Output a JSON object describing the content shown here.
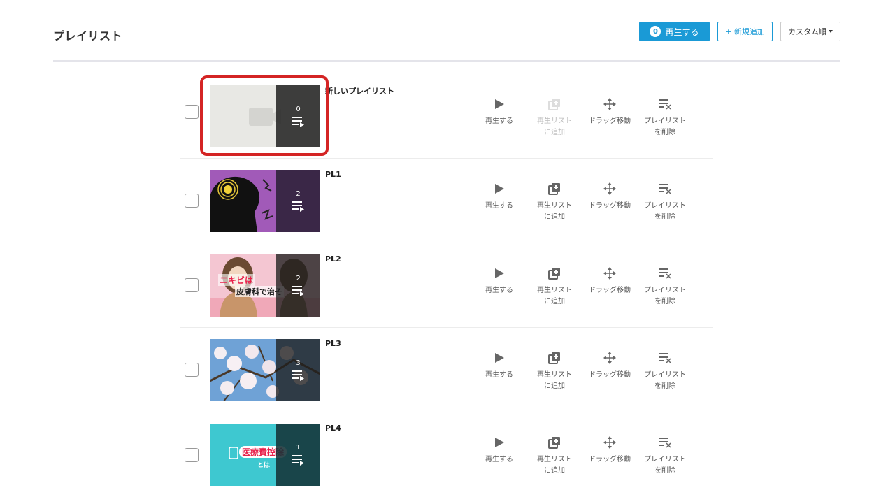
{
  "header": {
    "title": "プレイリスト",
    "play_count": "0",
    "play_label": "再生する",
    "new_label": "+ 新規追加",
    "sort_label": "カスタム順"
  },
  "actions": {
    "play": "再生する",
    "add_line1": "再生リスト",
    "add_line2": "に追加",
    "drag": "ドラッグ移動",
    "delete_line1": "プレイリスト",
    "delete_line2": "を削除"
  },
  "playlists": [
    {
      "name": "新しいプレイリスト",
      "count": "0",
      "thumb": "empty",
      "add_enabled": false
    },
    {
      "name": "PL1",
      "count": "2",
      "thumb": "head",
      "add_enabled": true
    },
    {
      "name": "PL2",
      "count": "2",
      "thumb": "girl",
      "add_enabled": true,
      "thumb_text1": "ニキビは",
      "thumb_text2": "皮膚科で治そ"
    },
    {
      "name": "PL3",
      "count": "3",
      "thumb": "sakura",
      "add_enabled": true
    },
    {
      "name": "PL4",
      "count": "1",
      "thumb": "teal",
      "add_enabled": true,
      "thumb_text1": "医療費控除",
      "thumb_text2": "とは"
    }
  ],
  "colors": {
    "accent": "#1a9ad6",
    "highlight": "#d42424",
    "overlay": "#1e1e1e"
  },
  "icons": [
    "play-icon",
    "add-to-playlist-icon",
    "drag-move-icon",
    "delete-playlist-icon",
    "playlist-icon"
  ]
}
